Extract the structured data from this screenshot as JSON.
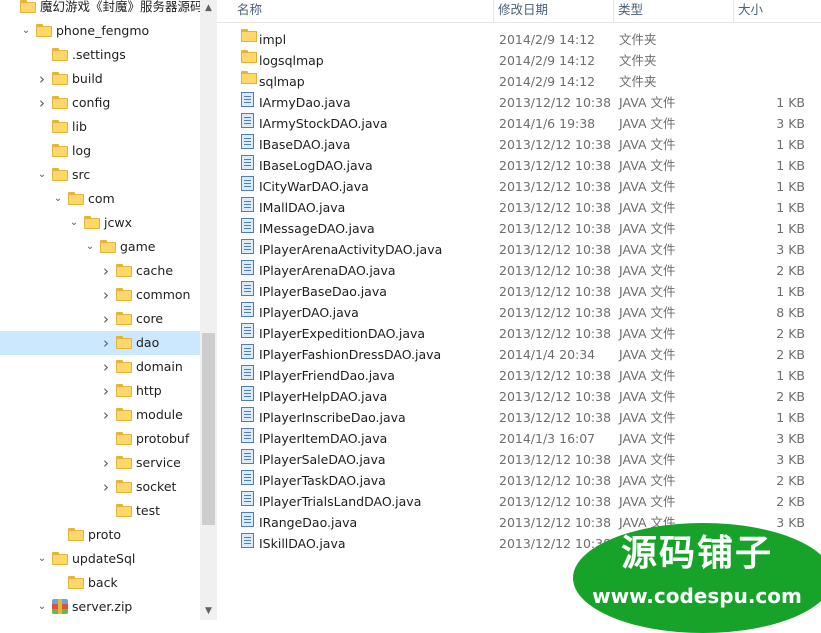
{
  "tree": [
    {
      "label": "魔幻游戏《封魔》服务器源码",
      "level": 0,
      "chevron": "",
      "icon": "folder"
    },
    {
      "label": "phone_fengmo",
      "level": 1,
      "chevron": "down",
      "icon": "folder"
    },
    {
      "label": ".settings",
      "level": 2,
      "chevron": "",
      "icon": "folder"
    },
    {
      "label": "build",
      "level": 2,
      "chevron": "right",
      "icon": "folder"
    },
    {
      "label": "config",
      "level": 2,
      "chevron": "right",
      "icon": "folder"
    },
    {
      "label": "lib",
      "level": 2,
      "chevron": "",
      "icon": "folder"
    },
    {
      "label": "log",
      "level": 2,
      "chevron": "",
      "icon": "folder"
    },
    {
      "label": "src",
      "level": 2,
      "chevron": "down",
      "icon": "folder"
    },
    {
      "label": "com",
      "level": 3,
      "chevron": "down",
      "icon": "folder"
    },
    {
      "label": "jcwx",
      "level": 4,
      "chevron": "down",
      "icon": "folder"
    },
    {
      "label": "game",
      "level": 5,
      "chevron": "down",
      "icon": "folder"
    },
    {
      "label": "cache",
      "level": 6,
      "chevron": "right",
      "icon": "folder"
    },
    {
      "label": "common",
      "level": 6,
      "chevron": "right",
      "icon": "folder"
    },
    {
      "label": "core",
      "level": 6,
      "chevron": "right",
      "icon": "folder"
    },
    {
      "label": "dao",
      "level": 6,
      "chevron": "right",
      "icon": "folder",
      "selected": true
    },
    {
      "label": "domain",
      "level": 6,
      "chevron": "right",
      "icon": "folder"
    },
    {
      "label": "http",
      "level": 6,
      "chevron": "right",
      "icon": "folder"
    },
    {
      "label": "module",
      "level": 6,
      "chevron": "right",
      "icon": "folder"
    },
    {
      "label": "protobuf",
      "level": 6,
      "chevron": "",
      "icon": "folder"
    },
    {
      "label": "service",
      "level": 6,
      "chevron": "right",
      "icon": "folder"
    },
    {
      "label": "socket",
      "level": 6,
      "chevron": "right",
      "icon": "folder"
    },
    {
      "label": "test",
      "level": 6,
      "chevron": "",
      "icon": "folder"
    },
    {
      "label": "proto",
      "level": 3,
      "chevron": "",
      "icon": "folder"
    },
    {
      "label": "updateSql",
      "level": 2,
      "chevron": "down",
      "icon": "folder"
    },
    {
      "label": "back",
      "level": 3,
      "chevron": "",
      "icon": "folder"
    },
    {
      "label": "server.zip",
      "level": 2,
      "chevron": "down",
      "icon": "zip-archive-icon"
    }
  ],
  "columns": {
    "name": "名称",
    "date": "修改日期",
    "type": "类型",
    "size": "大小"
  },
  "files": [
    {
      "name": "impl",
      "date": "2014/2/9 14:12",
      "type": "文件夹",
      "size": "",
      "kind": "folder"
    },
    {
      "name": "logsqlmap",
      "date": "2014/2/9 14:12",
      "type": "文件夹",
      "size": "",
      "kind": "folder"
    },
    {
      "name": "sqlmap",
      "date": "2014/2/9 14:12",
      "type": "文件夹",
      "size": "",
      "kind": "folder"
    },
    {
      "name": "IArmyDao.java",
      "date": "2013/12/12 10:38",
      "type": "JAVA 文件",
      "size": "1 KB",
      "kind": "file"
    },
    {
      "name": "IArmyStockDAO.java",
      "date": "2014/1/6 19:38",
      "type": "JAVA 文件",
      "size": "3 KB",
      "kind": "file"
    },
    {
      "name": "IBaseDAO.java",
      "date": "2013/12/12 10:38",
      "type": "JAVA 文件",
      "size": "1 KB",
      "kind": "file"
    },
    {
      "name": "IBaseLogDAO.java",
      "date": "2013/12/12 10:38",
      "type": "JAVA 文件",
      "size": "1 KB",
      "kind": "file"
    },
    {
      "name": "ICityWarDAO.java",
      "date": "2013/12/12 10:38",
      "type": "JAVA 文件",
      "size": "1 KB",
      "kind": "file"
    },
    {
      "name": "IMallDAO.java",
      "date": "2013/12/12 10:38",
      "type": "JAVA 文件",
      "size": "1 KB",
      "kind": "file"
    },
    {
      "name": "IMessageDAO.java",
      "date": "2013/12/12 10:38",
      "type": "JAVA 文件",
      "size": "1 KB",
      "kind": "file"
    },
    {
      "name": "IPlayerArenaActivityDAO.java",
      "date": "2013/12/12 10:38",
      "type": "JAVA 文件",
      "size": "3 KB",
      "kind": "file"
    },
    {
      "name": "IPlayerArenaDAO.java",
      "date": "2013/12/12 10:38",
      "type": "JAVA 文件",
      "size": "2 KB",
      "kind": "file"
    },
    {
      "name": "IPlayerBaseDao.java",
      "date": "2013/12/12 10:38",
      "type": "JAVA 文件",
      "size": "1 KB",
      "kind": "file"
    },
    {
      "name": "IPlayerDAO.java",
      "date": "2013/12/12 10:38",
      "type": "JAVA 文件",
      "size": "8 KB",
      "kind": "file"
    },
    {
      "name": "IPlayerExpeditionDAO.java",
      "date": "2013/12/12 10:38",
      "type": "JAVA 文件",
      "size": "2 KB",
      "kind": "file"
    },
    {
      "name": "IPlayerFashionDressDAO.java",
      "date": "2014/1/4 20:34",
      "type": "JAVA 文件",
      "size": "2 KB",
      "kind": "file"
    },
    {
      "name": "IPlayerFriendDao.java",
      "date": "2013/12/12 10:38",
      "type": "JAVA 文件",
      "size": "1 KB",
      "kind": "file"
    },
    {
      "name": "IPlayerHelpDAO.java",
      "date": "2013/12/12 10:38",
      "type": "JAVA 文件",
      "size": "2 KB",
      "kind": "file"
    },
    {
      "name": "IPlayerInscribeDao.java",
      "date": "2013/12/12 10:38",
      "type": "JAVA 文件",
      "size": "1 KB",
      "kind": "file"
    },
    {
      "name": "IPlayerItemDAO.java",
      "date": "2014/1/3 16:07",
      "type": "JAVA 文件",
      "size": "3 KB",
      "kind": "file"
    },
    {
      "name": "IPlayerSaleDAO.java",
      "date": "2013/12/12 10:38",
      "type": "JAVA 文件",
      "size": "3 KB",
      "kind": "file"
    },
    {
      "name": "IPlayerTaskDAO.java",
      "date": "2013/12/12 10:38",
      "type": "JAVA 文件",
      "size": "2 KB",
      "kind": "file"
    },
    {
      "name": "IPlayerTrialsLandDAO.java",
      "date": "2013/12/12 10:38",
      "type": "JAVA 文件",
      "size": "2 KB",
      "kind": "file"
    },
    {
      "name": "IRangeDao.java",
      "date": "2013/12/12 10:38",
      "type": "JAVA 文件",
      "size": "3 KB",
      "kind": "file"
    },
    {
      "name": "ISkillDAO.java",
      "date": "2013/12/12 10:38",
      "type": "",
      "size": "",
      "kind": "file"
    }
  ],
  "watermark": {
    "title": "源码铺子",
    "url": "www.codespu.com"
  },
  "colors": {
    "selection": "#cce8ff",
    "folder": "#ffd76a",
    "watermark": "#17a32a"
  }
}
